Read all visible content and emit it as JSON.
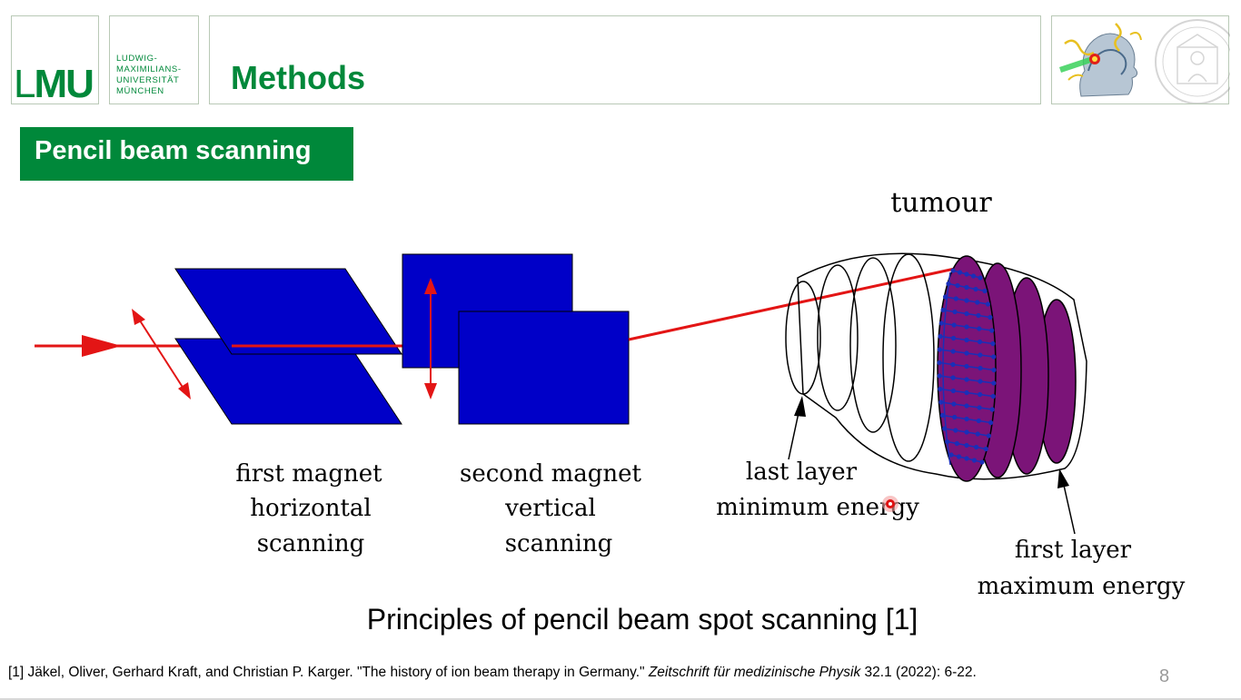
{
  "header": {
    "logo_lmu_thin": "L",
    "logo_lmu_bold": "MU",
    "university_lines": [
      "LUDWIG-",
      "MAXIMILIANS-",
      "UNIVERSITÄT",
      "MÜNCHEN"
    ],
    "title": "Methods"
  },
  "section_label": "Pencil beam scanning",
  "diagram": {
    "labels": {
      "tumour": "tumour",
      "first_magnet": [
        "first magnet",
        "horizontal",
        "scanning"
      ],
      "second_magnet": [
        "second magnet",
        "vertical",
        "scanning"
      ],
      "last_layer": [
        "last layer",
        "minimum energy"
      ],
      "first_layer": [
        "first layer",
        "maximum energy"
      ]
    },
    "colors": {
      "magnet": "#0000c8",
      "beam": "#e31515",
      "layer": "#7b1478",
      "spots": "#1a2fb8"
    }
  },
  "caption": "Principles of pencil beam spot scanning [1]",
  "reference": {
    "prefix": "[1] Jäkel, Oliver, Gerhard Kraft, and Christian P. Karger. \"The history of ion beam therapy in Germany.\" ",
    "journal": "Zeitschrift für medizinische Physik",
    "suffix": " 32.1 (2022): 6-22."
  },
  "page_number": "8",
  "icons": {
    "head_logo": "head-beam-logo-icon",
    "seal": "university-seal-icon",
    "pointer": "laser-pointer-icon"
  }
}
